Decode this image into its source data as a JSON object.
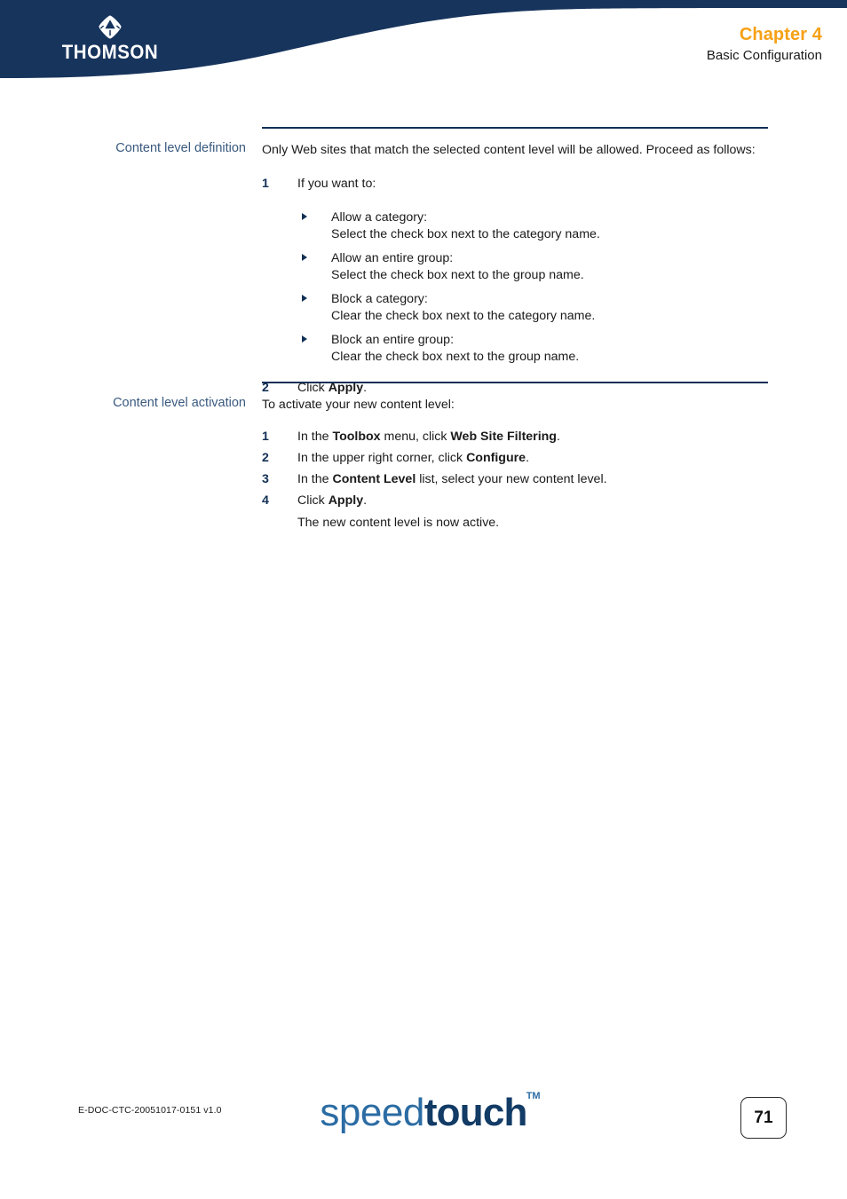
{
  "header": {
    "brand": "THOMSON",
    "brand_mark_icon": "thomson-diamond-logo",
    "chapter": "Chapter 4",
    "chapter_subtitle": "Basic Configuration",
    "chapter_color": "#f6a117",
    "banner_color": "#17345c"
  },
  "sections": [
    {
      "heading": "Content level definition",
      "intro": "Only Web sites that match the selected content level will be allowed. Proceed as follows:",
      "steps": [
        {
          "num": "1",
          "text": "If you want to:"
        },
        {
          "num": "2",
          "text_pre": "Click ",
          "text_bold": "Apply",
          "text_post": "."
        }
      ],
      "bullets": [
        {
          "label": "Allow a category:",
          "detail": "Select the check box next to the category name."
        },
        {
          "label": "Allow an entire group:",
          "detail": "Select the check box next to the group name."
        },
        {
          "label": "Block a category:",
          "detail": "Clear the check box next to the category name."
        },
        {
          "label": "Block an entire group:",
          "detail": "Clear the check box next to the group name."
        }
      ]
    },
    {
      "heading": "Content level activation",
      "intro": "To activate your new content level:",
      "steps": [
        {
          "num": "1",
          "pre": "In the ",
          "bold1": "Toolbox",
          "mid": " menu, click ",
          "bold2": "Web Site Filtering",
          "post": "."
        },
        {
          "num": "2",
          "pre": "In the upper right corner, click ",
          "bold1": "Configure",
          "mid": "",
          "bold2": "",
          "post": "."
        },
        {
          "num": "3",
          "pre": "In the ",
          "bold1": "Content Level",
          "mid": " list, select your new content level.",
          "bold2": "",
          "post": ""
        },
        {
          "num": "4",
          "pre": "Click ",
          "bold1": "Apply",
          "mid": "",
          "bold2": "",
          "post": "."
        }
      ],
      "note": "The new content level is now active."
    }
  ],
  "footer": {
    "doc_code": "E-DOC-CTC-20051017-0151 v1.0",
    "logo_speed": "speed",
    "logo_touch": "touch",
    "logo_tm": "TM",
    "page_number": "71"
  }
}
